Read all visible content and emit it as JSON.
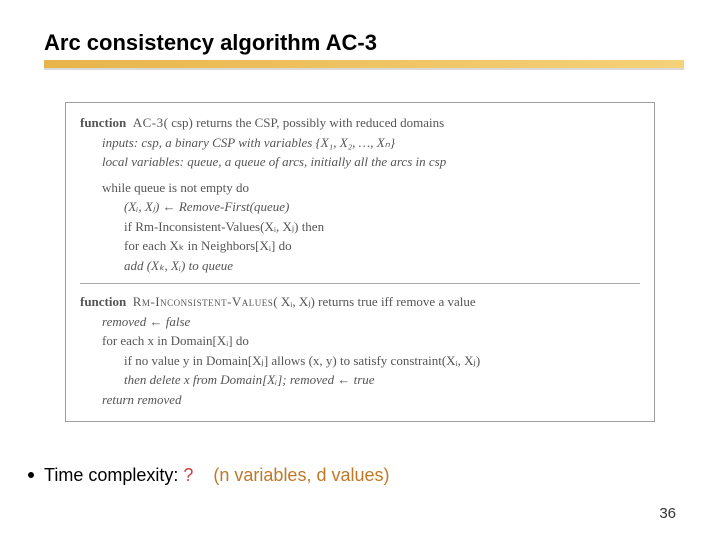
{
  "slide": {
    "title": "Arc consistency algorithm AC-3",
    "page_number": "36"
  },
  "algo": {
    "f1_head_a": "function",
    "f1_name": "AC-3",
    "f1_head_b": "( csp) returns the CSP, possibly with reduced domains",
    "f1_inputs": "inputs:  csp, a binary CSP with variables {X₁, X₂, …, Xₙ}",
    "f1_localvars": "local variables: queue, a queue of arcs, initially all the arcs in csp",
    "f1_while": "while queue is not empty do",
    "f1_pop": "(Xᵢ, Xⱼ) ← Remove-First(queue)",
    "f1_if": "if Rm-Inconsistent-Values(Xᵢ, Xⱼ) then",
    "f1_for": "for each Xₖ in Neighbors[Xᵢ] do",
    "f1_add": "add (Xₖ, Xᵢ) to queue",
    "f2_head_a": "function",
    "f2_name": "Rm-Inconsistent-Values",
    "f2_head_b": "( Xᵢ, Xⱼ) returns true iff remove a value",
    "f2_init": "removed ← false",
    "f2_forx": "for each x in Domain[Xᵢ] do",
    "f2_ify": "if no value y in Domain[Xⱼ] allows (x, y) to satisfy constraint(Xᵢ, Xⱼ)",
    "f2_del": "then delete x from Domain[Xᵢ];  removed ← true",
    "f2_ret": "return removed"
  },
  "bullet": {
    "prefix": "Time complexity: ",
    "q": "?",
    "note": "(n variables, d values)"
  }
}
